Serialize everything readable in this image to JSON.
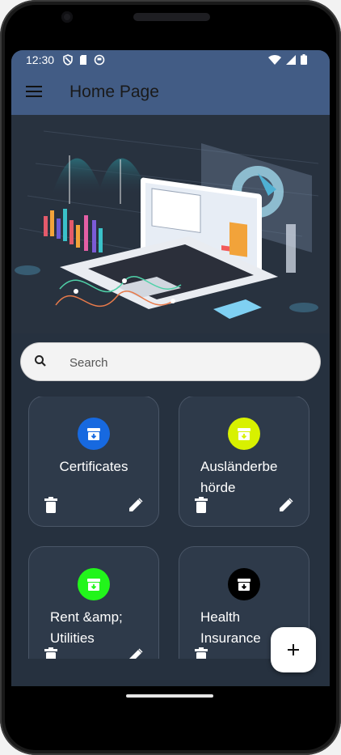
{
  "status": {
    "time": "12:30"
  },
  "app_bar": {
    "title": "Home Page"
  },
  "search": {
    "placeholder": "Search"
  },
  "cards": [
    {
      "label": "Certificates",
      "color": "#1769e0"
    },
    {
      "label": "Ausländerbe hörde",
      "color": "#d8f100"
    },
    {
      "label": "Rent &amp; Utilities",
      "color": "#22f51b"
    },
    {
      "label": "Health Insurance",
      "color": "#000000"
    }
  ],
  "icons": {
    "menu": "menu-icon",
    "search": "search-icon",
    "folder": "archive-icon",
    "delete": "trash-icon",
    "edit": "pencil-icon",
    "add": "plus-icon"
  },
  "colors": {
    "app_bar": "#425c85",
    "background": "#26313f",
    "card": "#2e3a4a"
  }
}
